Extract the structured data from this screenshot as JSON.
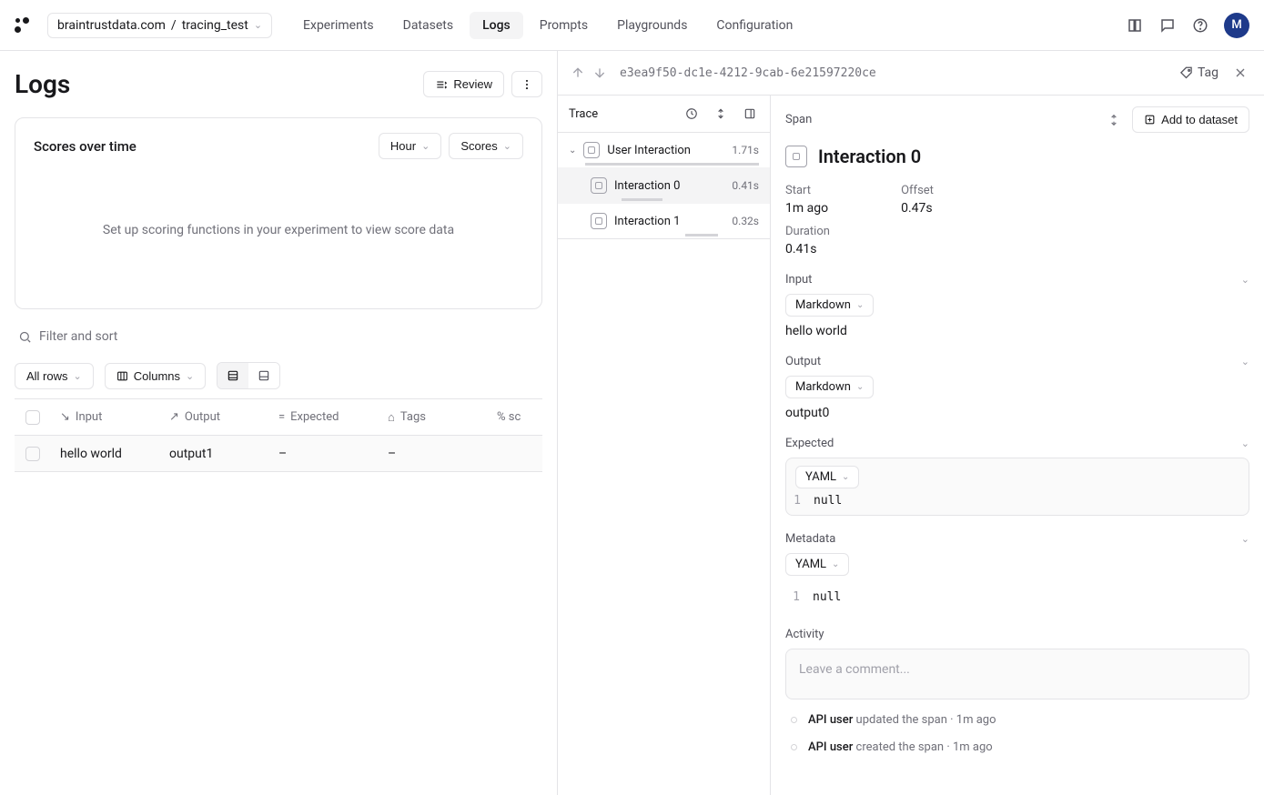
{
  "breadcrumb": {
    "org": "braintrustdata.com",
    "project": "tracing_test"
  },
  "nav": {
    "items": [
      "Experiments",
      "Datasets",
      "Logs",
      "Prompts",
      "Playgrounds",
      "Configuration"
    ],
    "active": "Logs"
  },
  "avatar": "M",
  "page": {
    "title": "Logs",
    "review_label": "Review"
  },
  "scores_card": {
    "title": "Scores over time",
    "granularity": "Hour",
    "metric": "Scores",
    "empty_msg": "Set up scoring functions in your experiment to view score data"
  },
  "filter": {
    "placeholder": "Filter and sort"
  },
  "toolbar": {
    "rows_label": "All rows",
    "columns_label": "Columns"
  },
  "table": {
    "headers": {
      "input": "Input",
      "output": "Output",
      "expected": "Expected",
      "tags": "Tags",
      "score": "% sc"
    },
    "rows": [
      {
        "input": "hello world",
        "output": "output1",
        "expected": "–",
        "tags": "–"
      }
    ]
  },
  "trace": {
    "id": "e3ea9f50-dc1e-4212-9cab-6e21597220ce",
    "tag_label": "Tag",
    "header": "Trace",
    "items": [
      {
        "label": "User Interaction",
        "time": "1.71s",
        "root": true
      },
      {
        "label": "Interaction 0",
        "time": "0.41s",
        "selected": true
      },
      {
        "label": "Interaction 1",
        "time": "0.32s"
      }
    ]
  },
  "span": {
    "header": "Span",
    "add_dataset_label": "Add to dataset",
    "title": "Interaction 0",
    "meta": {
      "start_label": "Start",
      "start_value": "1m ago",
      "offset_label": "Offset",
      "offset_value": "0.47s",
      "duration_label": "Duration",
      "duration_value": "0.41s"
    },
    "input": {
      "label": "Input",
      "format": "Markdown",
      "value": "hello world"
    },
    "output": {
      "label": "Output",
      "format": "Markdown",
      "value": "output0"
    },
    "expected": {
      "label": "Expected",
      "format": "YAML",
      "line": "1",
      "value": "null"
    },
    "metadata": {
      "label": "Metadata",
      "format": "YAML",
      "line": "1",
      "value": "null"
    },
    "activity": {
      "label": "Activity",
      "comment_placeholder": "Leave a comment...",
      "items": [
        {
          "who": "API user",
          "action": "updated the span",
          "when": "1m ago"
        },
        {
          "who": "API user",
          "action": "created the span",
          "when": "1m ago"
        }
      ]
    }
  }
}
